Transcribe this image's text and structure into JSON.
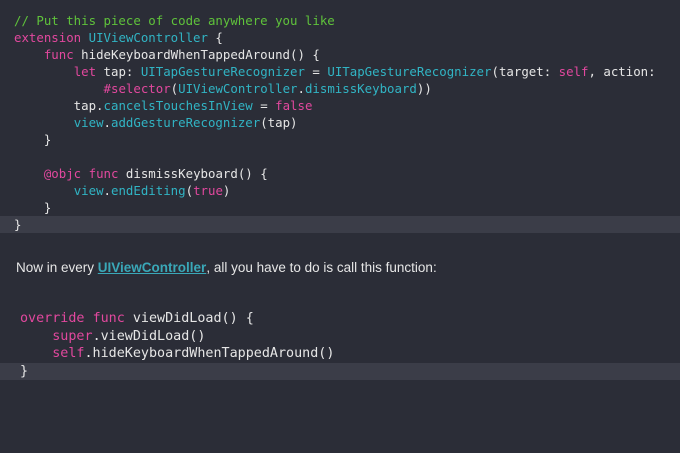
{
  "code_block_1": [
    {
      "highlight": false,
      "tokens": [
        {
          "c": "t-comment",
          "t": "// Put this piece of code anywhere you like"
        }
      ]
    },
    {
      "highlight": false,
      "tokens": [
        {
          "c": "t-kw",
          "t": "extension"
        },
        {
          "c": "t-plain",
          "t": " "
        },
        {
          "c": "t-type",
          "t": "UIViewController"
        },
        {
          "c": "t-plain",
          "t": " {"
        }
      ]
    },
    {
      "highlight": false,
      "tokens": [
        {
          "c": "t-plain",
          "t": "    "
        },
        {
          "c": "t-kw",
          "t": "func"
        },
        {
          "c": "t-plain",
          "t": " hideKeyboardWhenTappedAround() {"
        }
      ]
    },
    {
      "highlight": false,
      "tokens": [
        {
          "c": "t-plain",
          "t": "        "
        },
        {
          "c": "t-kw",
          "t": "let"
        },
        {
          "c": "t-plain",
          "t": " tap: "
        },
        {
          "c": "t-type",
          "t": "UITapGestureRecognizer"
        },
        {
          "c": "t-plain",
          "t": " = "
        },
        {
          "c": "t-type",
          "t": "UITapGestureRecognizer"
        },
        {
          "c": "t-plain",
          "t": "(target: "
        },
        {
          "c": "t-kw",
          "t": "self"
        },
        {
          "c": "t-plain",
          "t": ", action:"
        }
      ]
    },
    {
      "highlight": false,
      "tokens": [
        {
          "c": "t-plain",
          "t": "            "
        },
        {
          "c": "t-kw",
          "t": "#selector"
        },
        {
          "c": "t-plain",
          "t": "("
        },
        {
          "c": "t-type",
          "t": "UIViewController"
        },
        {
          "c": "t-plain",
          "t": "."
        },
        {
          "c": "t-type",
          "t": "dismissKeyboard"
        },
        {
          "c": "t-plain",
          "t": "))"
        }
      ]
    },
    {
      "highlight": false,
      "tokens": [
        {
          "c": "t-plain",
          "t": "        tap."
        },
        {
          "c": "t-type",
          "t": "cancelsTouchesInView"
        },
        {
          "c": "t-plain",
          "t": " = "
        },
        {
          "c": "t-kw",
          "t": "false"
        }
      ]
    },
    {
      "highlight": false,
      "tokens": [
        {
          "c": "t-plain",
          "t": "        "
        },
        {
          "c": "t-type",
          "t": "view"
        },
        {
          "c": "t-plain",
          "t": "."
        },
        {
          "c": "t-type",
          "t": "addGestureRecognizer"
        },
        {
          "c": "t-plain",
          "t": "(tap)"
        }
      ]
    },
    {
      "highlight": false,
      "tokens": [
        {
          "c": "t-plain",
          "t": "    }"
        }
      ]
    },
    {
      "highlight": false,
      "tokens": [
        {
          "c": "t-plain",
          "t": " "
        }
      ]
    },
    {
      "highlight": false,
      "tokens": [
        {
          "c": "t-plain",
          "t": "    "
        },
        {
          "c": "t-kw",
          "t": "@objc"
        },
        {
          "c": "t-plain",
          "t": " "
        },
        {
          "c": "t-kw",
          "t": "func"
        },
        {
          "c": "t-plain",
          "t": " dismissKeyboard() {"
        }
      ]
    },
    {
      "highlight": false,
      "tokens": [
        {
          "c": "t-plain",
          "t": "        "
        },
        {
          "c": "t-type",
          "t": "view"
        },
        {
          "c": "t-plain",
          "t": "."
        },
        {
          "c": "t-type",
          "t": "endEditing"
        },
        {
          "c": "t-plain",
          "t": "("
        },
        {
          "c": "t-kw",
          "t": "true"
        },
        {
          "c": "t-plain",
          "t": ")"
        }
      ]
    },
    {
      "highlight": false,
      "tokens": [
        {
          "c": "t-plain",
          "t": "    }"
        }
      ]
    },
    {
      "highlight": true,
      "tokens": [
        {
          "c": "t-plain",
          "t": "}"
        }
      ]
    }
  ],
  "prose": {
    "before": "Now in every ",
    "link": "UIViewController",
    "after": ", all you have to do is call this function:"
  },
  "code_block_2": [
    {
      "highlight": false,
      "tokens": [
        {
          "c": "t-kw",
          "t": "override"
        },
        {
          "c": "t-plain",
          "t": " "
        },
        {
          "c": "t-kw",
          "t": "func"
        },
        {
          "c": "t-plain",
          "t": " viewDidLoad() {"
        }
      ]
    },
    {
      "highlight": false,
      "tokens": [
        {
          "c": "t-plain",
          "t": "    "
        },
        {
          "c": "t-kw",
          "t": "super"
        },
        {
          "c": "t-plain",
          "t": ".viewDidLoad()"
        }
      ]
    },
    {
      "highlight": false,
      "tokens": [
        {
          "c": "t-plain",
          "t": "    "
        },
        {
          "c": "t-kw",
          "t": "self"
        },
        {
          "c": "t-plain",
          "t": ".hideKeyboardWhenTappedAround()"
        }
      ]
    },
    {
      "highlight": true,
      "tokens": [
        {
          "c": "t-plain",
          "t": "}"
        }
      ]
    }
  ]
}
